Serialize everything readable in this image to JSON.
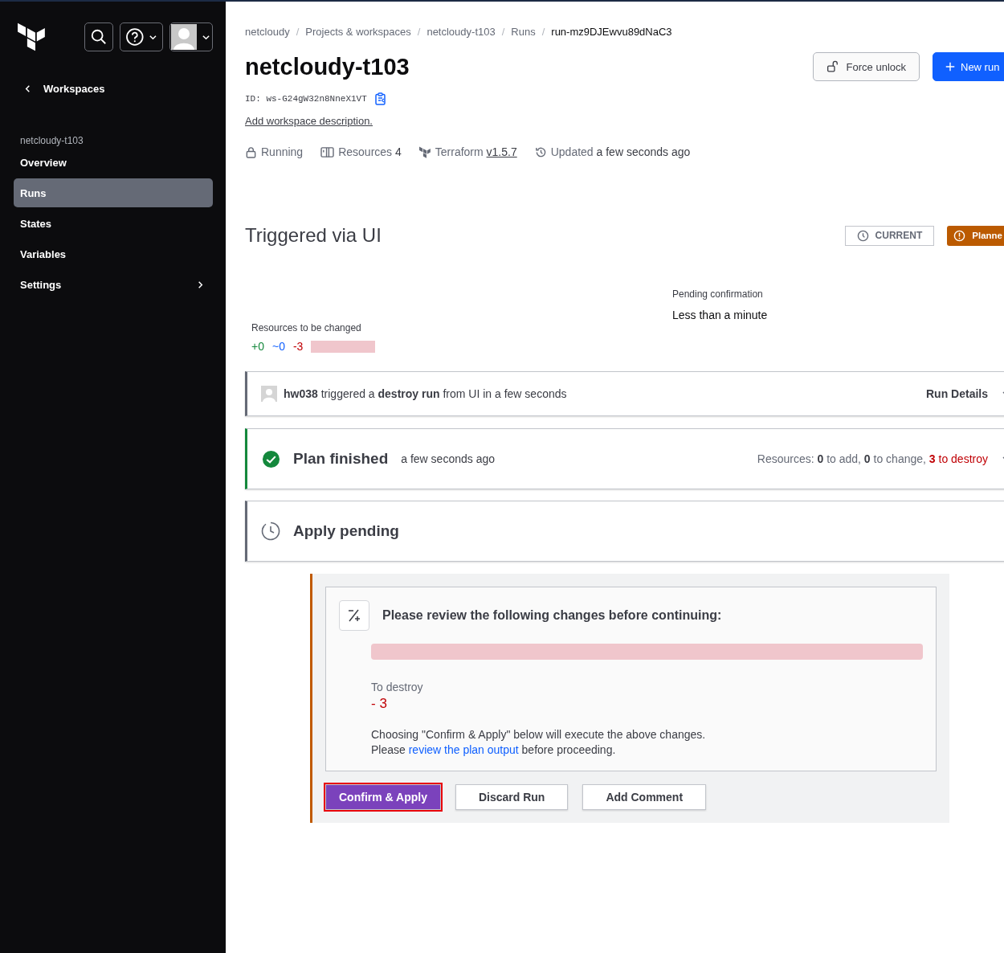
{
  "sidebar": {
    "back_label": "Workspaces",
    "workspace": "netcloudy-t103",
    "items": [
      {
        "label": "Overview",
        "selected": false,
        "kind": "plain"
      },
      {
        "label": "Runs",
        "selected": true,
        "kind": "plain"
      },
      {
        "label": "States",
        "selected": false,
        "kind": "plain"
      },
      {
        "label": "Variables",
        "selected": false,
        "kind": "plain"
      },
      {
        "label": "Settings",
        "selected": false,
        "kind": "submenu"
      }
    ]
  },
  "breadcrumb": {
    "separator": "/",
    "items": [
      {
        "label": "netcloudy",
        "current": false
      },
      {
        "label": "Projects & workspaces",
        "current": false
      },
      {
        "label": "netcloudy-t103",
        "current": false
      },
      {
        "label": "Runs",
        "current": false
      },
      {
        "label": "run-mz9DJEwvu89dNaC3",
        "current": true
      }
    ]
  },
  "workspace": {
    "title": "netcloudy-t103",
    "id_label": "ID:",
    "id": "ws-G24gW32n8NneX1VT",
    "description_link": "Add workspace description.",
    "meta": [
      {
        "kind": "lock",
        "label": "Running"
      },
      {
        "kind": "resources",
        "label": "Resources",
        "value": "4"
      },
      {
        "kind": "terraform",
        "label": "Terraform",
        "link": "v1.5.7"
      },
      {
        "kind": "history",
        "label": "Updated",
        "value": "a few seconds ago"
      }
    ]
  },
  "actions": [
    {
      "label": "Force unlock",
      "kind": "secondary"
    },
    {
      "label": "New run",
      "kind": "primary"
    }
  ],
  "run": {
    "title": "Triggered via UI",
    "badges": [
      {
        "label": "CURRENT",
        "kind": "current"
      },
      {
        "label": "Planne",
        "kind": "planned"
      }
    ],
    "pending_label": "Pending confirmation",
    "pending_value": "Less than a minute",
    "changes_label": "Resources to be changed",
    "changes": [
      {
        "text": "+0",
        "kind": "add"
      },
      {
        "text": "~0",
        "kind": "change"
      },
      {
        "text": "-3",
        "kind": "destroy"
      }
    ]
  },
  "timeline": [
    {
      "kind": "trigger",
      "text": "**hw038** triggered a **destroy run** from UI in a few seconds",
      "right": "Run Details"
    },
    {
      "kind": "plan",
      "title": "Plan finished",
      "time": "a few seconds ago",
      "summary": "Resources: **0** to add, **0** to change, ",
      "summary_destroy": "**3** to destroy"
    },
    {
      "kind": "apply",
      "title": "Apply pending"
    }
  ],
  "confirm": {
    "heading": "Please review the following changes before continuing:",
    "destroy_label": "To destroy",
    "destroy_value": "- 3",
    "note_line1": "Choosing \"Confirm & Apply\" below will execute the above changes.",
    "note_before": "Please ",
    "note_link": "review the plan output",
    "note_after": " before proceeding.",
    "buttons": [
      {
        "label": "Confirm & Apply",
        "kind": "primary",
        "highlighted": true
      },
      {
        "label": "Discard Run",
        "kind": "secondary",
        "highlighted": false
      },
      {
        "label": "Add Comment",
        "kind": "secondary",
        "highlighted": false
      }
    ]
  }
}
